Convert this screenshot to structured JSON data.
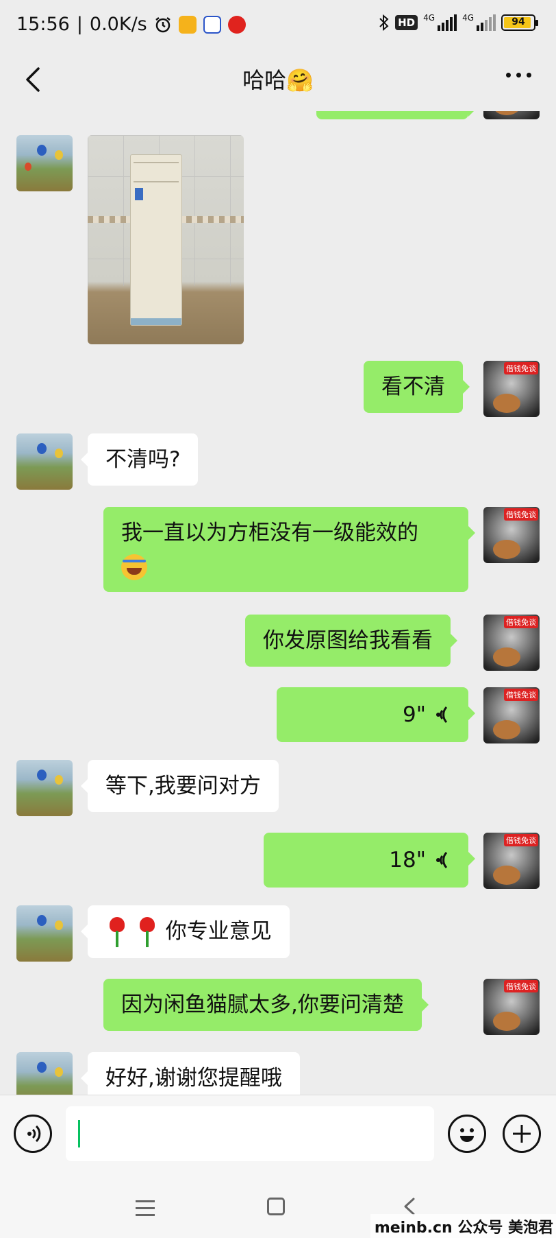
{
  "status_bar": {
    "time": "15:56",
    "net_speed": "0.0K/s",
    "network_1": "4G",
    "network_2": "4G",
    "hd_badge": "HD",
    "battery": "94",
    "icons": [
      "alarm-icon",
      "notes-app-icon",
      "app-notification-icon",
      "netease-music-icon",
      "bluetooth-icon",
      "signal-icon",
      "battery-icon"
    ]
  },
  "header": {
    "title": "哈哈🤗",
    "back_icon": "chevron-left-icon",
    "more_icon": "more-dots-icon"
  },
  "messages": [
    {
      "side": "left",
      "type": "image",
      "alt": "floor-standing-air-conditioner-photo"
    },
    {
      "side": "right",
      "type": "text",
      "text": "看不清"
    },
    {
      "side": "left",
      "type": "text",
      "text": "不清吗?"
    },
    {
      "side": "right",
      "type": "text",
      "text": "我一直以为方柜没有一级能效的",
      "emoji": "crying-laughing-emoji"
    },
    {
      "side": "right",
      "type": "text",
      "text": "你发原图给我看看"
    },
    {
      "side": "right",
      "type": "voice",
      "duration": "9\""
    },
    {
      "side": "left",
      "type": "text",
      "text": "等下,我要问对方"
    },
    {
      "side": "right",
      "type": "voice",
      "duration": "18\""
    },
    {
      "side": "left",
      "type": "text",
      "text": "你专业意见",
      "emoji": "rose-emoji"
    },
    {
      "side": "right",
      "type": "text",
      "text": "因为闲鱼猫腻太多,你要问清楚"
    },
    {
      "side": "left",
      "type": "text",
      "text": "好好,谢谢您提醒哦"
    }
  ],
  "avatar_right_tag": "借钱免谈",
  "input_bar": {
    "voice_icon": "voice-input-icon",
    "emoji_icon": "emoji-icon",
    "plus_icon": "plus-icon",
    "value": ""
  },
  "nav_bar": {
    "icons": [
      "menu-icon",
      "home-icon",
      "back-icon"
    ]
  },
  "watermark": "meinb.cn 公众号 美泡君",
  "colors": {
    "background": "#ededed",
    "bubble_self": "#95ec69",
    "bubble_other": "#ffffff",
    "caret": "#07c160"
  }
}
